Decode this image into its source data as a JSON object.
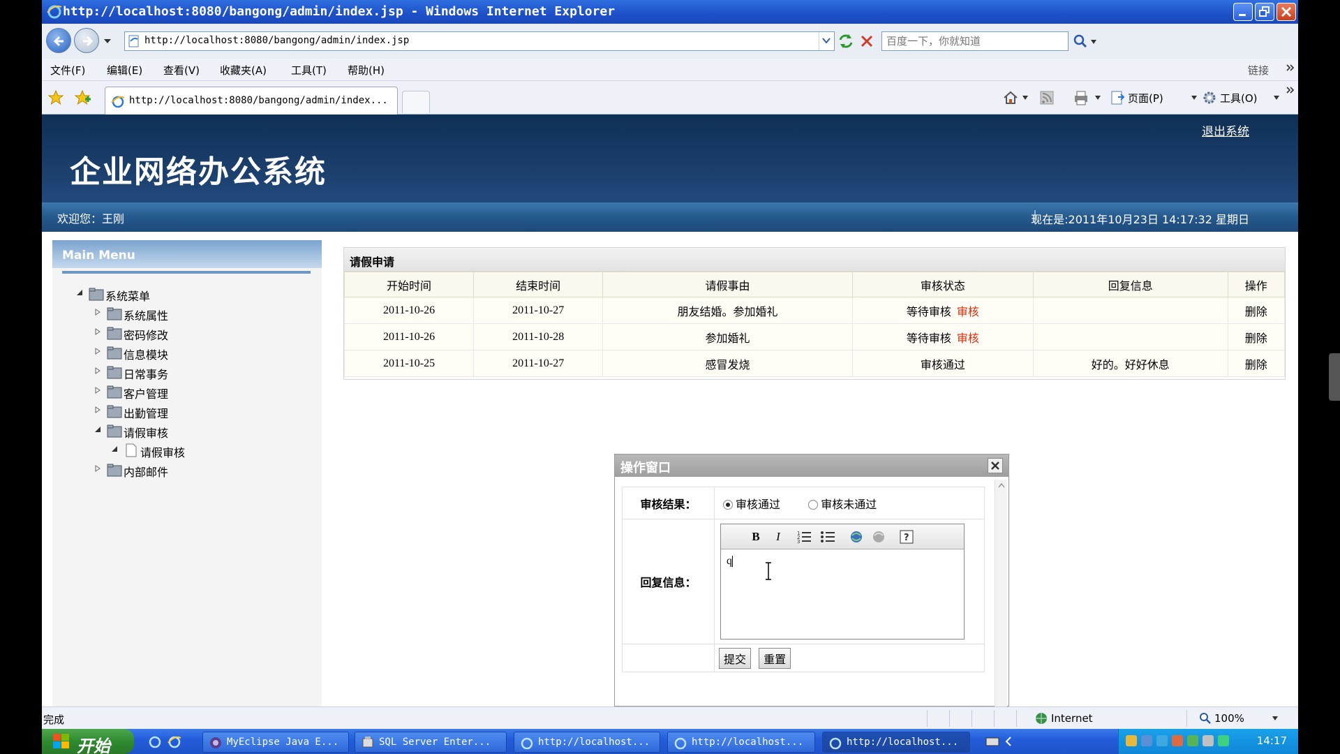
{
  "window": {
    "title": "http://localhost:8080/bangong/admin/index.jsp - Windows Internet Explorer"
  },
  "address": {
    "url": "http://localhost:8080/bangong/admin/index.jsp",
    "search_placeholder": "百度一下，你就知道"
  },
  "menu": {
    "items": [
      "文件(F)",
      "编辑(E)",
      "查看(V)",
      "收藏夹(A)",
      "工具(T)",
      "帮助(H)"
    ],
    "links": "链接"
  },
  "tabs": {
    "active_label": "http://localhost:8080/bangong/admin/index...",
    "page_label": "页面(P)",
    "tools_label": "工具(O)"
  },
  "page": {
    "system_title": "企业网络办公系统",
    "logout": "退出系统",
    "welcome": "欢迎您：王刚",
    "now": "现在是:2011年10月23日 14:17:32 星期日"
  },
  "sidebar": {
    "header": "Main Menu",
    "root": "系统菜单",
    "items": [
      {
        "label": "系统属性"
      },
      {
        "label": "密码修改"
      },
      {
        "label": "信息模块"
      },
      {
        "label": "日常事务"
      },
      {
        "label": "客户管理"
      },
      {
        "label": "出勤管理"
      },
      {
        "label": "请假审核"
      },
      {
        "label": "请假审核"
      },
      {
        "label": "内部邮件"
      }
    ]
  },
  "leave_table": {
    "title": "请假申请",
    "columns": [
      "开始时间",
      "结束时间",
      "请假事由",
      "审核状态",
      "回复信息",
      "操作"
    ],
    "rows": [
      {
        "start": "2011-10-26",
        "end": "2011-10-27",
        "reason": "朋友结婚。参加婚礼",
        "status": "等待审核",
        "audit_link": "审核",
        "reply": "",
        "action": "删除"
      },
      {
        "start": "2011-10-26",
        "end": "2011-10-28",
        "reason": "参加婚礼",
        "status": "等待审核",
        "audit_link": "审核",
        "reply": "",
        "action": "删除"
      },
      {
        "start": "2011-10-25",
        "end": "2011-10-27",
        "reason": "感冒发烧",
        "status": "审核通过",
        "audit_link": "",
        "reply": "好的。好好休息",
        "action": "删除"
      }
    ]
  },
  "dialog": {
    "title": "操作窗口",
    "result_label": "审核结果：",
    "option_pass": "审核通过",
    "option_fail": "审核未通过",
    "selected": "审核通过",
    "reply_label": "回复信息：",
    "reply_value": "q",
    "submit": "提交",
    "reset": "重置"
  },
  "statusbar": {
    "status": "完成",
    "zone": "Internet",
    "zoom": "100%"
  },
  "taskbar": {
    "start": "开始",
    "tasks": [
      "MyEclipse Java E...",
      "SQL Server Enter...",
      "http://localhost...",
      "http://localhost...",
      "http://localhost..."
    ],
    "clock": "14:17"
  },
  "colors": {
    "banner": "#1b3e6b",
    "audit_link": "#e02d0a",
    "taskbar": "#245edb"
  }
}
